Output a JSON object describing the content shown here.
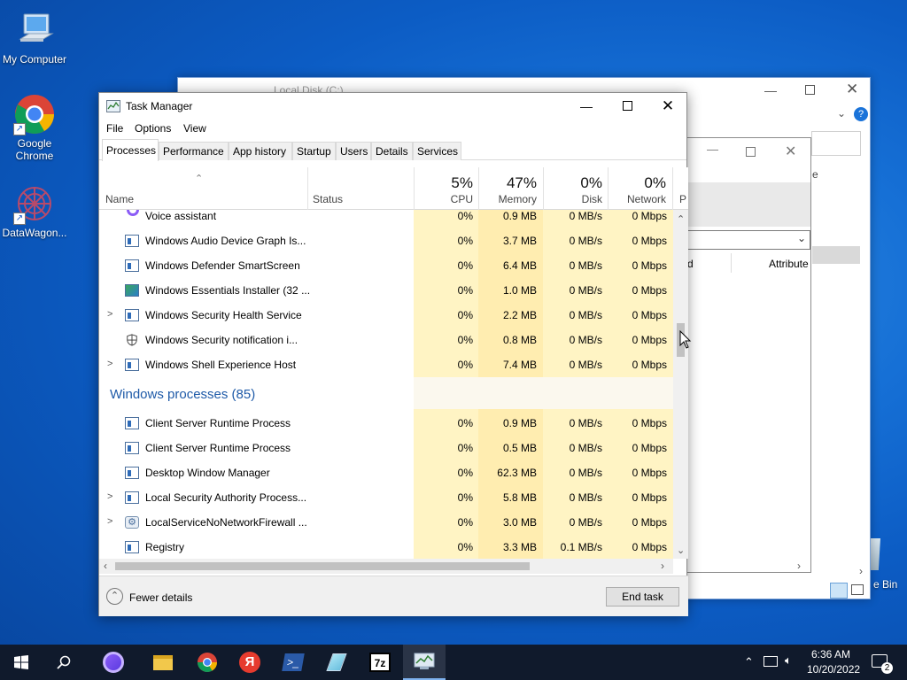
{
  "desktop": {
    "icons": [
      {
        "label": "My Computer"
      },
      {
        "label": "Google Chrome"
      },
      {
        "label": "DataWagon..."
      }
    ],
    "recycle_label": "e Bin"
  },
  "background_window": {
    "title": "Local Disk (C:)",
    "column_d": "d",
    "column_attributes": "Attribute",
    "letter_e": "e"
  },
  "task_manager": {
    "title": "Task Manager",
    "menu": [
      "File",
      "Options",
      "View"
    ],
    "tabs": [
      "Processes",
      "Performance",
      "App history",
      "Startup",
      "Users",
      "Details",
      "Services"
    ],
    "active_tab": "Processes",
    "columns": {
      "name": "Name",
      "status": "Status",
      "cpu": {
        "pct": "5%",
        "label": "CPU"
      },
      "memory": {
        "pct": "47%",
        "label": "Memory"
      },
      "disk": {
        "pct": "0%",
        "label": "Disk"
      },
      "network": {
        "pct": "0%",
        "label": "Network"
      },
      "power": "P"
    },
    "rows_top": [
      {
        "name": "Voice assistant",
        "cpu": "0%",
        "mem": "0.9 MB",
        "disk": "0 MB/s",
        "net": "0 Mbps",
        "icon": "voice-assistant-icon",
        "expand": false
      },
      {
        "name": "Windows Audio Device Graph Is...",
        "cpu": "0%",
        "mem": "3.7 MB",
        "disk": "0 MB/s",
        "net": "0 Mbps",
        "icon": "window-icon",
        "expand": false
      },
      {
        "name": "Windows Defender SmartScreen",
        "cpu": "0%",
        "mem": "6.4 MB",
        "disk": "0 MB/s",
        "net": "0 Mbps",
        "icon": "window-icon",
        "expand": false
      },
      {
        "name": "Windows Essentials Installer (32 ...",
        "cpu": "0%",
        "mem": "1.0 MB",
        "disk": "0 MB/s",
        "net": "0 Mbps",
        "icon": "installer-icon",
        "expand": false
      },
      {
        "name": "Windows Security Health Service",
        "cpu": "0%",
        "mem": "2.2 MB",
        "disk": "0 MB/s",
        "net": "0 Mbps",
        "icon": "window-icon",
        "expand": true
      },
      {
        "name": "Windows Security notification i...",
        "cpu": "0%",
        "mem": "0.8 MB",
        "disk": "0 MB/s",
        "net": "0 Mbps",
        "icon": "shield-icon",
        "expand": false
      },
      {
        "name": "Windows Shell Experience Host",
        "cpu": "0%",
        "mem": "7.4 MB",
        "disk": "0 MB/s",
        "net": "0 Mbps",
        "icon": "window-icon",
        "expand": true
      }
    ],
    "group_label": "Windows processes (85)",
    "rows_bottom": [
      {
        "name": "Client Server Runtime Process",
        "cpu": "0%",
        "mem": "0.9 MB",
        "disk": "0 MB/s",
        "net": "0 Mbps",
        "icon": "window-icon",
        "expand": false
      },
      {
        "name": "Client Server Runtime Process",
        "cpu": "0%",
        "mem": "0.5 MB",
        "disk": "0 MB/s",
        "net": "0 Mbps",
        "icon": "window-icon",
        "expand": false
      },
      {
        "name": "Desktop Window Manager",
        "cpu": "0%",
        "mem": "62.3 MB",
        "disk": "0 MB/s",
        "net": "0 Mbps",
        "icon": "window-icon",
        "expand": false
      },
      {
        "name": "Local Security Authority Process...",
        "cpu": "0%",
        "mem": "5.8 MB",
        "disk": "0 MB/s",
        "net": "0 Mbps",
        "icon": "window-icon",
        "expand": true
      },
      {
        "name": "LocalServiceNoNetworkFirewall ...",
        "cpu": "0%",
        "mem": "3.0 MB",
        "disk": "0 MB/s",
        "net": "0 Mbps",
        "icon": "gear-icon",
        "expand": true
      },
      {
        "name": "Registry",
        "cpu": "0%",
        "mem": "3.3 MB",
        "disk": "0.1 MB/s",
        "net": "0 Mbps",
        "icon": "window-icon",
        "expand": false
      }
    ],
    "fewer_details": "Fewer details",
    "end_task": "End task"
  },
  "taskbar": {
    "time": "6:36 AM",
    "date": "10/20/2022",
    "notification_count": "2",
    "colors": {
      "bar": "#101a2c",
      "accent": "#7fb2ef"
    }
  }
}
